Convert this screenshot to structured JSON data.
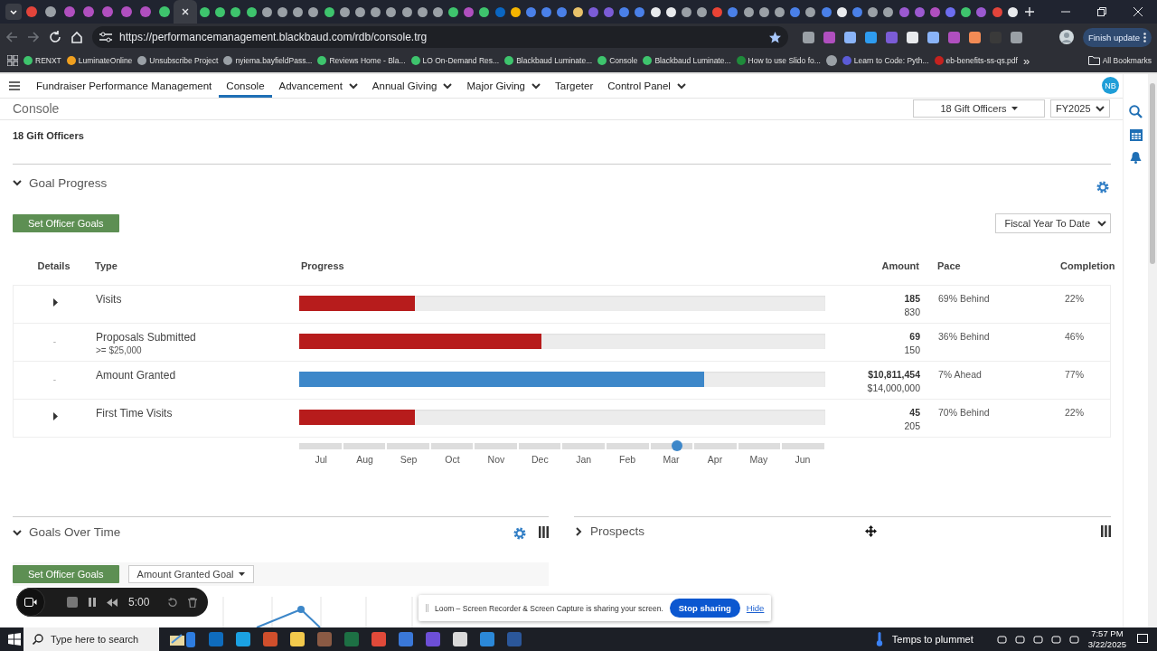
{
  "browser": {
    "url": "https://performancemanagement.blackbaud.com/rdb/console.trg",
    "update_button": "Finish update",
    "bookmarks": [
      {
        "label": "RENXT",
        "color": "#3ec46d"
      },
      {
        "label": "LuminateOnline",
        "color": "#f0a020"
      },
      {
        "label": "Unsubscribe Project",
        "color": "#9aa0a6"
      },
      {
        "label": "nyiema.bayfieldPass...",
        "color": "#9aa0a6"
      },
      {
        "label": "Reviews Home - Bla...",
        "color": "#3ec46d"
      },
      {
        "label": "LO On-Demand Res...",
        "color": "#3ec46d"
      },
      {
        "label": "Blackbaud Luminate...",
        "color": "#3ec46d"
      },
      {
        "label": "Console",
        "color": "#3ec46d"
      },
      {
        "label": "Blackbaud Luminate...",
        "color": "#3ec46d"
      },
      {
        "label": "How to use Slido fo...",
        "color": "#1f8a3b"
      },
      {
        "label": "Learn to Code: Pyth...",
        "color": "#5b5bd6"
      },
      {
        "label": "eb-benefits-ss-qs.pdf",
        "color": "#c5221f"
      }
    ],
    "more_bookmarks": "»",
    "all_bookmarks": "All Bookmarks"
  },
  "nav": {
    "app_title": "Fundraiser Performance Management",
    "items": [
      {
        "label": "Console",
        "selected": true,
        "has_menu": false
      },
      {
        "label": "Advancement",
        "selected": false,
        "has_menu": true
      },
      {
        "label": "Annual Giving",
        "selected": false,
        "has_menu": true
      },
      {
        "label": "Major Giving",
        "selected": false,
        "has_menu": true
      },
      {
        "label": "Targeter",
        "selected": false,
        "has_menu": false
      },
      {
        "label": "Control Panel",
        "selected": false,
        "has_menu": true
      }
    ],
    "avatar": "NB"
  },
  "header": {
    "title": "Console",
    "officer_filter": "18 Gift Officers",
    "fiscal_year": "FY2025"
  },
  "subtitle": "18 Gift Officers",
  "goal_progress": {
    "title": "Goal Progress",
    "expanded": true,
    "button": "Set Officer Goals",
    "period": "Fiscal Year To Date",
    "columns": [
      "Details",
      "Type",
      "Progress",
      "Amount",
      "Pace",
      "Completion"
    ],
    "rows": [
      {
        "details": "",
        "expanded": false,
        "type": "Visits",
        "subtype": "",
        "level": 0.22,
        "color": "#b71c1c",
        "amount": "185",
        "target": "830",
        "pace": "69% Behind",
        "completion": "22%"
      },
      {
        "details": "-",
        "type": "Proposals Submitted",
        "subtype": ">= $25,000",
        "level": 0.46,
        "color": "#b71c1c",
        "amount": "69",
        "target": "150",
        "pace": "36% Behind",
        "completion": "46%"
      },
      {
        "details": "-",
        "type": "Amount Granted",
        "subtype": "",
        "level": 0.77,
        "color": "#3d87c9",
        "amount": "$10,811,454",
        "target": "$14,000,000",
        "pace": "7% Ahead",
        "completion": "77%"
      },
      {
        "details": "",
        "expanded": false,
        "type": "First Time Visits",
        "subtype": "",
        "level": 0.22,
        "color": "#b71c1c",
        "amount": "45",
        "target": "205",
        "pace": "70% Behind",
        "completion": "22%"
      }
    ],
    "timeline": {
      "months": [
        "Jul",
        "Aug",
        "Sep",
        "Oct",
        "Nov",
        "Dec",
        "Jan",
        "Feb",
        "Mar",
        "Apr",
        "May",
        "Jun"
      ],
      "level": 0.72
    }
  },
  "goals_over_time": {
    "title": "Goals Over Time",
    "expanded": true,
    "button": "Set Officer Goals",
    "goal_select": "Amount Granted Goal"
  },
  "prospects": {
    "title": "Prospects",
    "expanded": false
  },
  "recorder": {
    "timer": "5:00"
  },
  "share_bar": {
    "message": "Loom – Screen Recorder & Screen Capture is sharing your screen.",
    "stop": "Stop sharing",
    "hide": "Hide"
  },
  "taskbar": {
    "search": "Type here to search",
    "weather": "Temps to plummet",
    "time": "7:57 PM",
    "date": "3/22/2025"
  }
}
